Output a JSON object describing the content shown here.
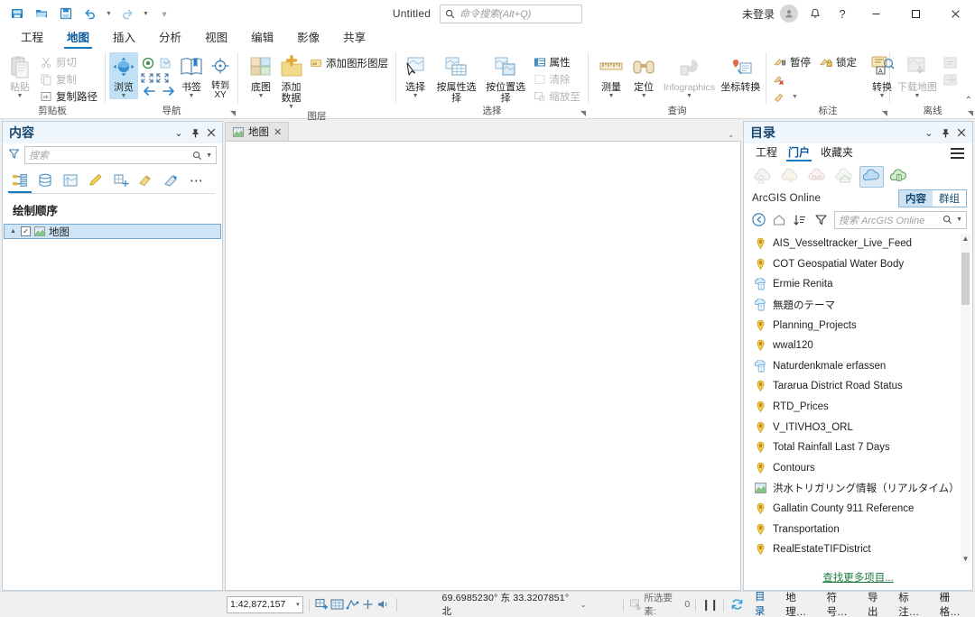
{
  "titlebar": {
    "doc_title": "Untitled",
    "search_placeholder": "命令搜索(Alt+Q)",
    "signin_label": "未登录",
    "quick_access": [
      {
        "name": "save-project-icon"
      },
      {
        "name": "open-project-icon"
      },
      {
        "name": "save-as-icon"
      },
      {
        "name": "undo-icon"
      },
      {
        "name": "redo-icon"
      },
      {
        "name": "customize-qat-icon"
      }
    ],
    "window_buttons": {
      "minimize": "—",
      "maximize": "❐",
      "close": "✕"
    },
    "help_glyph": "?",
    "notification_glyph": "bell"
  },
  "ribbon": {
    "tabs": [
      {
        "label": "工程",
        "active": false
      },
      {
        "label": "地图",
        "active": true
      },
      {
        "label": "插入",
        "active": false
      },
      {
        "label": "分析",
        "active": false
      },
      {
        "label": "视图",
        "active": false
      },
      {
        "label": "编辑",
        "active": false
      },
      {
        "label": "影像",
        "active": false
      },
      {
        "label": "共享",
        "active": false
      }
    ],
    "groups": [
      {
        "caption": "剪贴板",
        "has_dialog_launcher": false,
        "big": [
          {
            "label": "粘贴",
            "icon": "paste-icon",
            "dropdown": true,
            "disabled": true
          }
        ],
        "small": [
          {
            "label": "剪切",
            "icon": "cut-icon",
            "disabled": true
          },
          {
            "label": "复制",
            "icon": "copy-icon",
            "disabled": true
          },
          {
            "label": "复制路径",
            "icon": "copy-path-icon",
            "disabled": false
          }
        ]
      },
      {
        "caption": "导航",
        "has_dialog_launcher": true,
        "big": [
          {
            "label": "浏览",
            "icon": "explore-icon",
            "dropdown": true,
            "selected": true
          },
          {
            "label": "书签",
            "icon": "bookmarks-icon",
            "dropdown": true
          },
          {
            "label": "转到 XY",
            "icon": "go-to-xy-icon",
            "dropdown": false
          }
        ],
        "mini_icons": [
          "full-extent-icon",
          "fixed-zoom-in-icon",
          "previous-extent-icon",
          "next-extent-icon"
        ]
      },
      {
        "caption": "图层",
        "has_dialog_launcher": false,
        "big": [
          {
            "label": "底图",
            "icon": "basemap-icon",
            "dropdown": true
          },
          {
            "label": "添加数据",
            "icon": "add-data-icon",
            "dropdown": true
          }
        ],
        "small": [
          {
            "label": "添加图形图层",
            "icon": "add-graphics-layer-icon"
          }
        ]
      },
      {
        "caption": "选择",
        "has_dialog_launcher": true,
        "big": [
          {
            "label": "选择",
            "icon": "select-icon",
            "dropdown": true
          },
          {
            "label": "按属性选择",
            "icon": "select-by-attributes-icon"
          },
          {
            "label": "按位置选择",
            "icon": "select-by-location-icon"
          }
        ],
        "small": [
          {
            "label": "属性",
            "icon": "attributes-icon",
            "disabled": false
          },
          {
            "label": "清除",
            "icon": "clear-selection-icon",
            "disabled": true
          },
          {
            "label": "缩放至",
            "icon": "zoom-to-selection-icon",
            "disabled": true
          }
        ]
      },
      {
        "caption": "查询",
        "has_dialog_launcher": false,
        "big": [
          {
            "label": "测量",
            "icon": "measure-icon",
            "dropdown": true
          },
          {
            "label": "定位",
            "icon": "locate-icon",
            "dropdown": true
          },
          {
            "label": "Infographics",
            "icon": "infographics-icon",
            "dropdown": true,
            "disabled": true
          },
          {
            "label": "坐标转换",
            "icon": "coordinate-conversion-icon"
          }
        ]
      },
      {
        "caption": "标注",
        "has_dialog_launcher": true,
        "big": [
          {
            "label": "转换",
            "icon": "convert-labels-icon",
            "dropdown": true
          }
        ],
        "small": [
          {
            "label": "暂停",
            "icon": "pause-labeling-icon"
          },
          {
            "label": "锁定",
            "icon": "lock-labels-icon"
          },
          {
            "label": "",
            "icon": "clear-labels-icon"
          },
          {
            "label": "",
            "icon": "label-style-icon",
            "dropdown": true
          }
        ]
      },
      {
        "caption": "离线",
        "has_dialog_launcher": true,
        "big": [
          {
            "label": "下载地图",
            "icon": "download-map-icon",
            "dropdown": true,
            "disabled": true
          }
        ],
        "small": [
          {
            "label": "",
            "icon": "sync-icon",
            "disabled": true
          },
          {
            "label": "",
            "icon": "manage-replica-icon",
            "disabled": true
          }
        ]
      }
    ],
    "collapse_glyph": "⌃"
  },
  "contents_pane": {
    "title": "内容",
    "search_placeholder": "搜索",
    "header_actions": [
      "menu-chevron-icon",
      "pin-icon",
      "close-icon"
    ],
    "toolbar_icons": [
      "list-by-drawing-order-icon",
      "list-by-data-source-icon",
      "list-by-selection-icon",
      "list-by-editing-icon",
      "list-by-snapping-icon",
      "list-by-labeling-icon",
      "list-by-diagram-icon",
      "more-options-icon"
    ],
    "section_label": "绘制顺序",
    "tree": [
      {
        "label": "地图",
        "checked": true,
        "selected": true,
        "icon": "map-icon"
      }
    ]
  },
  "map_view": {
    "tab_label": "地图",
    "tab_icon": "map-icon",
    "close_glyph": "✕",
    "tabs_overflow_glyph": "⌄"
  },
  "catalog_pane": {
    "title": "目录",
    "header_actions": [
      "menu-chevron-icon",
      "pin-icon",
      "close-icon"
    ],
    "tabs": [
      {
        "label": "工程",
        "active": false
      },
      {
        "label": "门户",
        "active": true
      },
      {
        "label": "收藏夹",
        "active": false
      }
    ],
    "portal_icons": [
      {
        "name": "my-content-icon",
        "selected": false
      },
      {
        "name": "my-favorites-icon",
        "selected": false
      },
      {
        "name": "my-groups-icon",
        "selected": false
      },
      {
        "name": "my-organization-icon",
        "selected": false
      },
      {
        "name": "arcgis-online-icon",
        "selected": true
      },
      {
        "name": "living-atlas-icon",
        "selected": false
      }
    ],
    "portal_name": "ArcGIS Online",
    "segmented": [
      {
        "label": "内容",
        "active": true
      },
      {
        "label": "群组",
        "active": false
      }
    ],
    "toolbar": [
      "back-icon",
      "home-icon",
      "sort-icon",
      "filter-icon"
    ],
    "search_placeholder": "搜索 ArcGIS Online",
    "items": [
      {
        "name": "RealEstateTIFDistrict",
        "icon": "feature-layer-icon"
      },
      {
        "name": "Transportation",
        "icon": "feature-layer-icon"
      },
      {
        "name": "Gallatin County 911 Reference",
        "icon": "feature-layer-icon"
      },
      {
        "name": "洪水トリガリング情報（リアルタイム）",
        "icon": "map-icon"
      },
      {
        "name": "Contours",
        "icon": "feature-layer-icon"
      },
      {
        "name": "Total Rainfall Last 7 Days",
        "icon": "feature-layer-icon"
      },
      {
        "name": "V_ITIVHO3_ORL",
        "icon": "feature-layer-icon"
      },
      {
        "name": "RTD_Prices",
        "icon": "feature-layer-icon"
      },
      {
        "name": "Tararua District Road Status",
        "icon": "feature-layer-icon"
      },
      {
        "name": "Naturdenkmale erfassen",
        "icon": "web-app-icon"
      },
      {
        "name": "wwal120",
        "icon": "feature-layer-icon"
      },
      {
        "name": "Planning_Projects",
        "icon": "feature-layer-icon"
      },
      {
        "name": "無題のテーマ",
        "icon": "web-app-icon"
      },
      {
        "name": "Ermie Renita",
        "icon": "web-app-icon"
      },
      {
        "name": "COT Geospatial Water Body",
        "icon": "feature-layer-icon"
      },
      {
        "name": "AIS_Vesseltracker_Live_Feed",
        "icon": "feature-layer-icon"
      }
    ],
    "find_more_label": "查找更多项目..."
  },
  "statusbar": {
    "scale": "1:42,872,157",
    "scale_dropdown_glyph": "▾",
    "tools": [
      "insert-scale-icon",
      "grid-icon",
      "transform-icon",
      "add-point-icon",
      "audio-icon"
    ],
    "coordinates": "69.6985230° 东  33.3207851° 北",
    "coords_dropdown_glyph": "⌄",
    "selected_label": "所选要素:",
    "selected_count": "0",
    "pause_glyph": "⏸",
    "refresh_icon": "refresh-icon",
    "bottom_tabs": [
      {
        "label": "目录",
        "active": true
      },
      {
        "label": "地理…",
        "active": false
      },
      {
        "label": "符号…",
        "active": false
      },
      {
        "label": "导出",
        "active": false
      },
      {
        "label": "标注…",
        "active": false
      },
      {
        "label": "栅格…",
        "active": false
      }
    ]
  },
  "colors": {
    "accent": "#0b7bc1",
    "pane_header_bg": "#eef5fb",
    "pane_title": "#18466e",
    "selection": "#cfe4f5",
    "ribbon_selected": "#bfe0f5",
    "link_green": "#1d7a3f"
  }
}
